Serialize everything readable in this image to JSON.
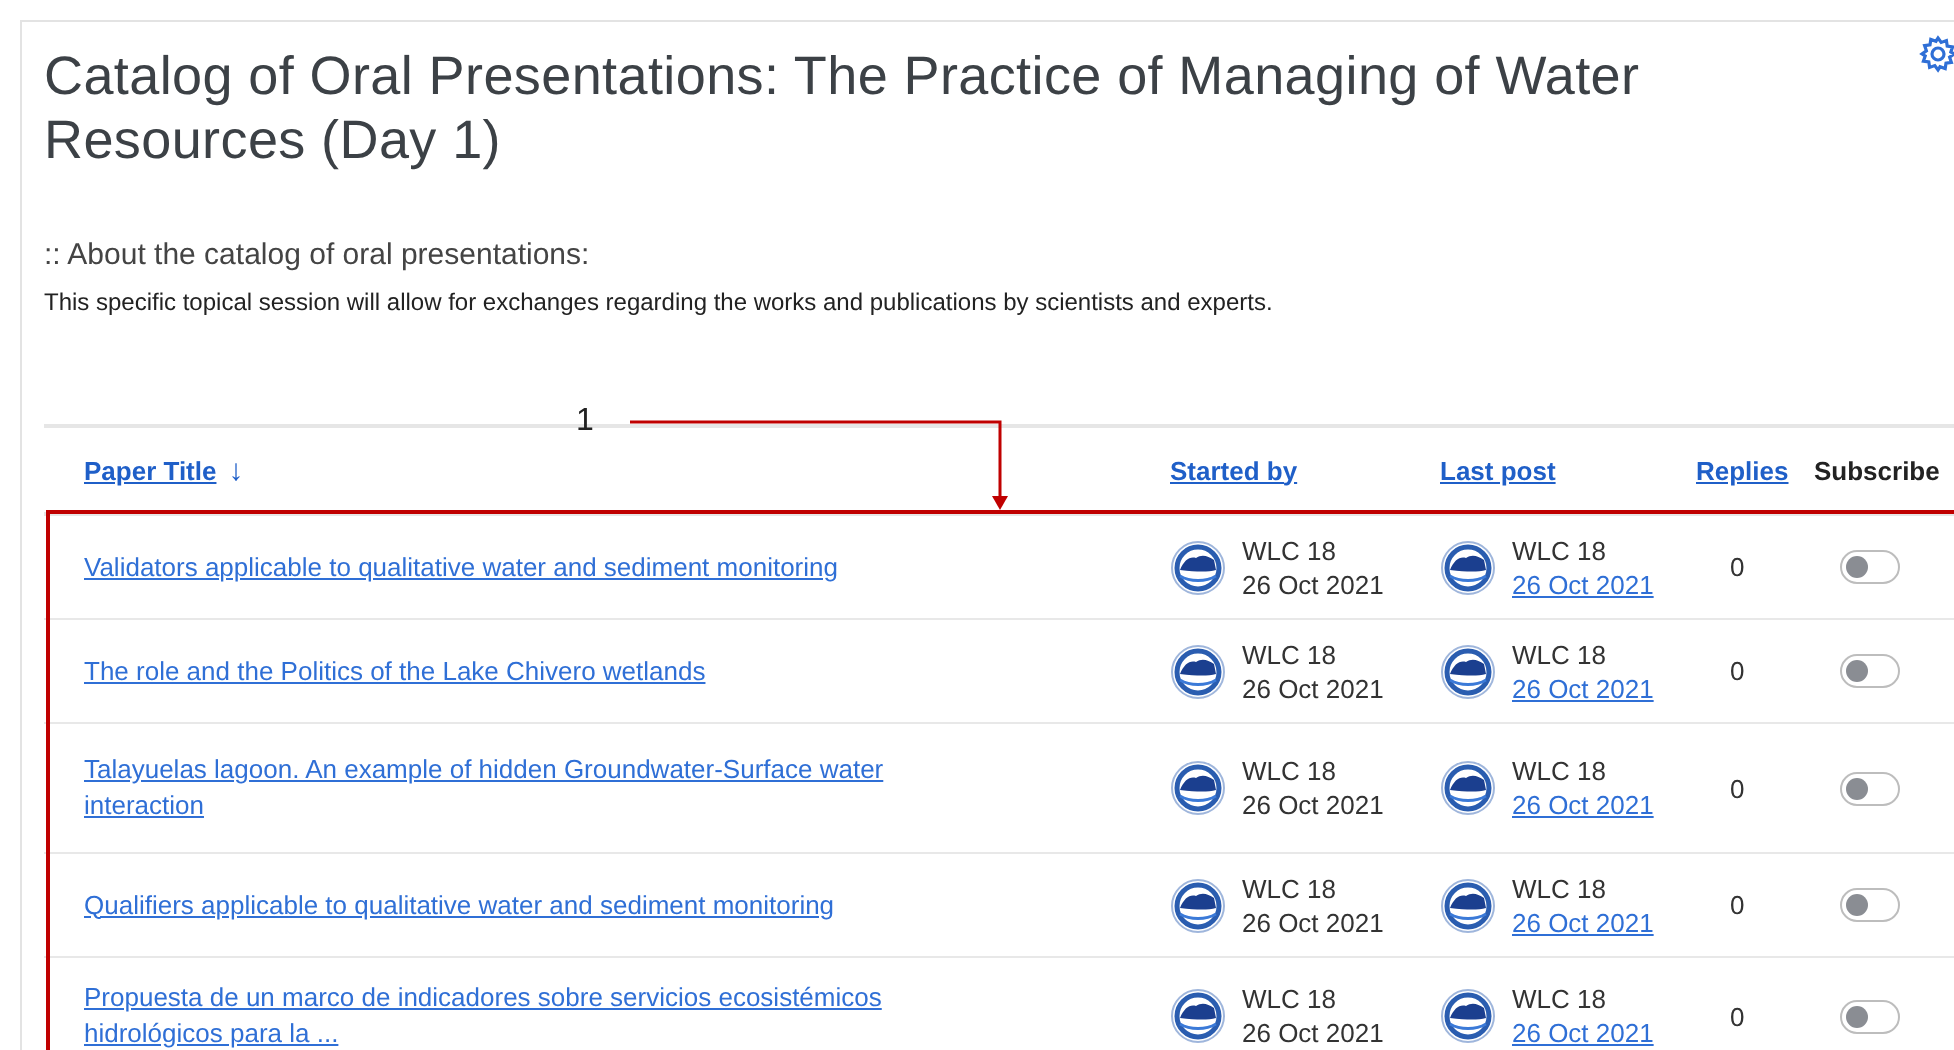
{
  "page": {
    "title": "Catalog of Oral Presentations: The Practice of Managing of Water Resources (Day 1)",
    "about_heading": ":: About the catalog of oral presentations:",
    "description": "This specific topical session will allow for exchanges regarding the works and publications by scientists and experts."
  },
  "annotation": {
    "label": "1"
  },
  "table": {
    "columns": [
      {
        "label": "Paper Title",
        "kind": "link",
        "sort_arrow": "↓"
      },
      {
        "label": "Started by",
        "kind": "link"
      },
      {
        "label": "Last post",
        "kind": "link"
      },
      {
        "label": "Replies",
        "kind": "link"
      },
      {
        "label": "Subscribe",
        "kind": "plain"
      }
    ],
    "rows": [
      {
        "title": "Validators applicable to qualitative water and sediment monitoring",
        "started_by": {
          "name": "WLC 18",
          "date": "26 Oct 2021"
        },
        "last_post": {
          "name": "WLC 18",
          "date": "26 Oct 2021"
        },
        "replies": "0",
        "subscribed": false
      },
      {
        "title": "The role and the Politics of the Lake Chivero wetlands",
        "started_by": {
          "name": "WLC 18",
          "date": "26 Oct 2021"
        },
        "last_post": {
          "name": "WLC 18",
          "date": "26 Oct 2021"
        },
        "replies": "0",
        "subscribed": false
      },
      {
        "title": "Talayuelas lagoon. An example of hidden Groundwater-Surface water interaction",
        "started_by": {
          "name": "WLC 18",
          "date": "26 Oct 2021"
        },
        "last_post": {
          "name": "WLC 18",
          "date": "26 Oct 2021"
        },
        "replies": "0",
        "subscribed": false
      },
      {
        "title": "Qualifiers applicable to qualitative water and sediment monitoring",
        "started_by": {
          "name": "WLC 18",
          "date": "26 Oct 2021"
        },
        "last_post": {
          "name": "WLC 18",
          "date": "26 Oct 2021"
        },
        "replies": "0",
        "subscribed": false
      },
      {
        "title": "Propuesta de un marco de indicadores sobre servicios ecosistémicos hidrológicos para la ...",
        "started_by": {
          "name": "WLC 18",
          "date": "26 Oct 2021"
        },
        "last_post": {
          "name": "WLC 18",
          "date": "26 Oct 2021"
        },
        "replies": "0",
        "subscribed": false
      }
    ]
  }
}
